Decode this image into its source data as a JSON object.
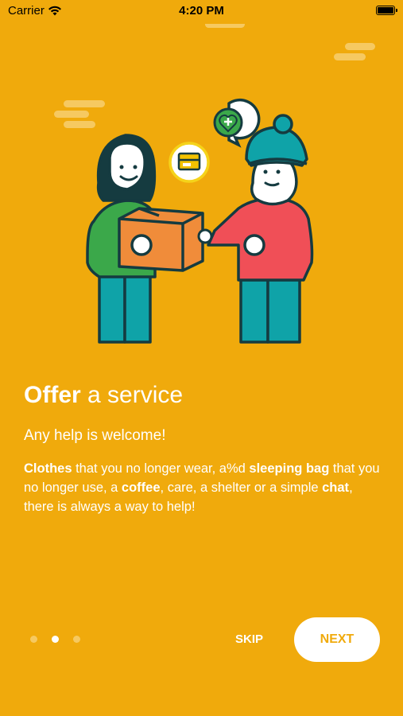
{
  "status_bar": {
    "carrier": "Carrier",
    "time": "4:20 PM"
  },
  "colors": {
    "background": "#F0AA0C",
    "accent_light": "#F6C961",
    "person_left_shirt": "#3BA84A",
    "person_right_shirt": "#F04F57",
    "pants": "#0FA3A8",
    "box": "#F08C3A",
    "outline": "#153B40"
  },
  "onboarding": {
    "title_bold": "Offer",
    "title_rest": " a service",
    "subtitle": "Any help is welcome!",
    "body": [
      {
        "text": "Clothes",
        "bold": true
      },
      {
        "text": " that you no longer wear, a%d ",
        "bold": false
      },
      {
        "text": "sleeping bag",
        "bold": true
      },
      {
        "text": " that you no longer use, a ",
        "bold": false
      },
      {
        "text": "coffee",
        "bold": true
      },
      {
        "text": ", care, a shelter or a simple ",
        "bold": false
      },
      {
        "text": "chat",
        "bold": true
      },
      {
        "text": ", there is always a way to help!",
        "bold": false
      }
    ]
  },
  "pagination": {
    "total": 3,
    "current": 2
  },
  "actions": {
    "skip_label": "SKIP",
    "next_label": "NEXT"
  }
}
